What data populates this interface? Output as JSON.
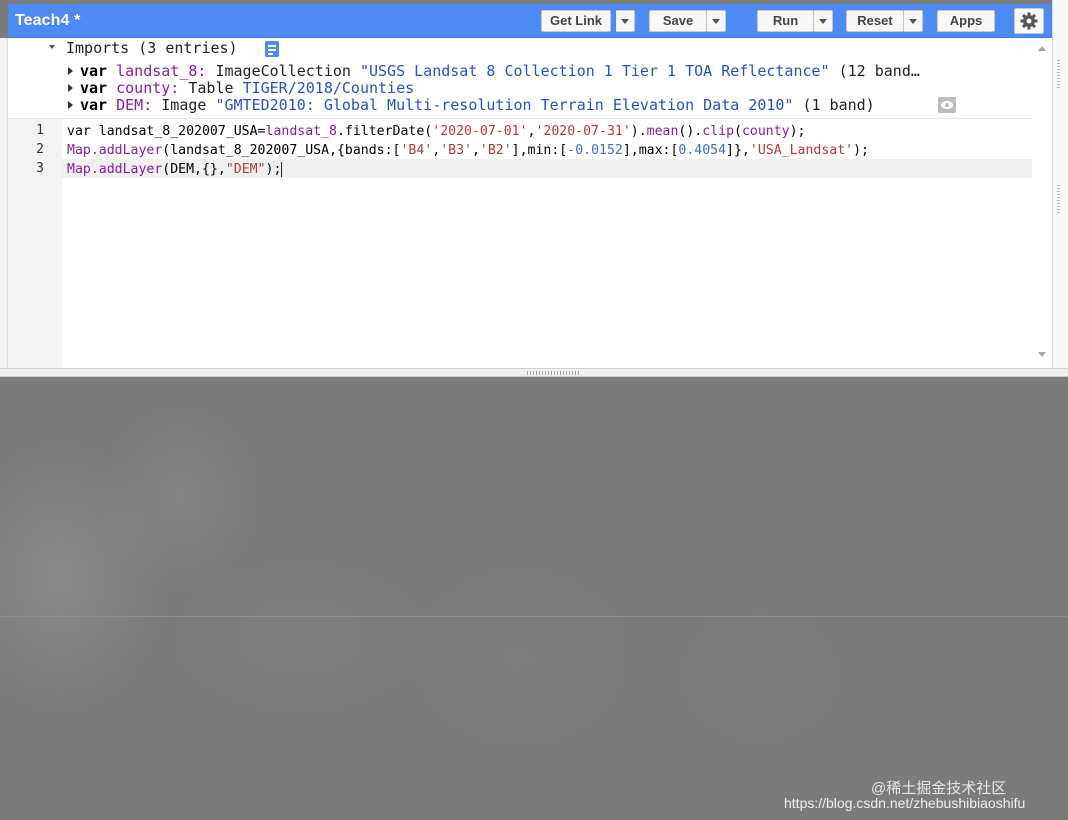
{
  "header": {
    "title": "Teach4 *",
    "buttons": {
      "get_link": "Get Link",
      "save": "Save",
      "run": "Run",
      "reset": "Reset",
      "apps": "Apps"
    },
    "accent_color": "#4c8bf5"
  },
  "imports": {
    "header": "Imports (3 entries)",
    "entries": [
      {
        "kw": "var",
        "name": "landsat_8:",
        "type": "ImageCollection",
        "value": "\"USGS Landsat 8 Collection 1 Tier 1 TOA Reflectance\"",
        "extra": "(12 band…"
      },
      {
        "kw": "var",
        "name": "county:",
        "type": "Table",
        "value": "TIGER/2018/Counties",
        "extra": ""
      },
      {
        "kw": "var",
        "name": "DEM:",
        "type": "Image",
        "value": "\"GMTED2010: Global Multi-resolution Terrain Elevation Data 2010\"",
        "extra": "(1 band)"
      }
    ]
  },
  "editor": {
    "line_numbers": [
      "1",
      "2",
      "3"
    ],
    "line1": {
      "a": "var landsat_8_202007_USA=",
      "b": "landsat_8",
      "c": ".filterDate(",
      "d": "'2020-07-01'",
      "e": ",",
      "f": "'2020-07-31'",
      "g": ").",
      "h": "mean",
      "i": "().",
      "j": "clip",
      "k": "(",
      "l": "county",
      "m": ");"
    },
    "line2": {
      "a": "Map.addLayer",
      "b": "(landsat_8_202007_USA,{bands:[",
      "c": "'B4'",
      "d": ",",
      "e": "'B3'",
      "f": ",",
      "g": "'B2'",
      "h": "],min:[",
      "i": "-0.0152",
      "j": "],max:[",
      "k": "0.4054",
      "l": "]},",
      "m": "'USA_Landsat'",
      "n": ");"
    },
    "line3": {
      "a": "Map.addLayer",
      "b": "(DEM,{},",
      "c": "\"DEM\"",
      "d": ");"
    }
  },
  "watermark": {
    "line1": "@稀土掘金技术社区",
    "line2": "https://blog.csdn.net/zhebushibiaoshifu"
  }
}
